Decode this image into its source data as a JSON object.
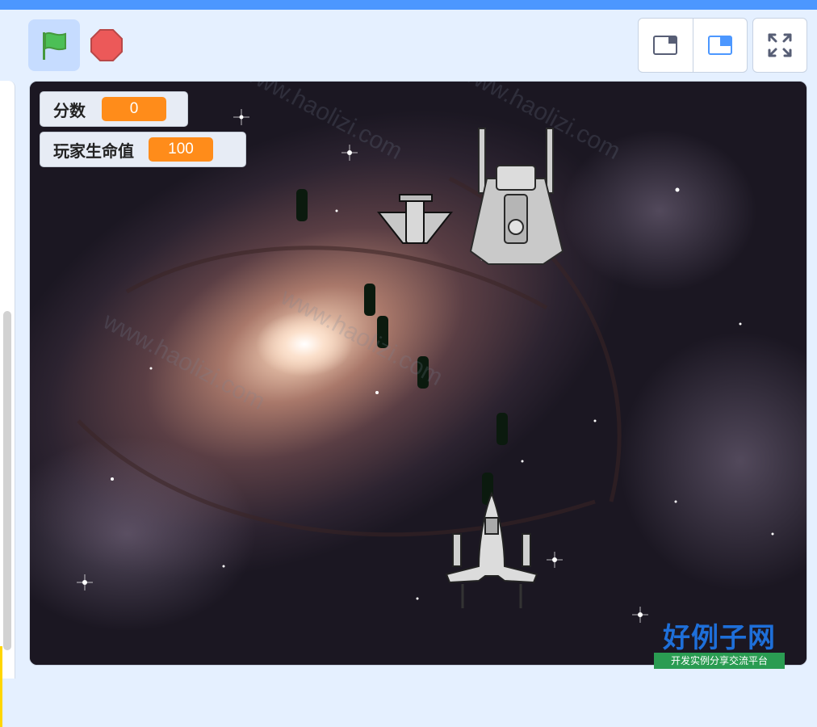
{
  "controls": {
    "green_flag_icon": "green-flag-icon",
    "stop_icon": "stop-sign-icon",
    "small_stage_icon": "small-stage-icon",
    "normal_stage_icon": "normal-stage-icon",
    "fullscreen_icon": "fullscreen-icon"
  },
  "monitors": {
    "score": {
      "label": "分数",
      "value": "0"
    },
    "player_hp": {
      "label": "玩家生命值",
      "value": "100"
    }
  },
  "watermark": "www.haolizi.com",
  "logo": {
    "title": "好例子网",
    "subtitle": "开发实例分享交流平台"
  },
  "colors": {
    "accent": "#4c97ff",
    "monitor_value": "#ff8c1a",
    "background": "#e5f0ff"
  }
}
